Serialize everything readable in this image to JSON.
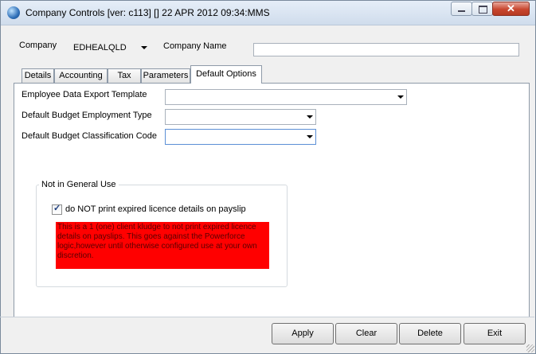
{
  "window": {
    "title": "Company Controls  [ver: c113] [] 22 APR 2012 09:34:MMS",
    "close_glyph": "✕"
  },
  "header": {
    "company_label": "Company",
    "company_value": "EDHEALQLD",
    "company_name_label": "Company Name",
    "company_name_value": ""
  },
  "tabs": [
    {
      "label": "Details"
    },
    {
      "label": "Accounting"
    },
    {
      "label": "Tax"
    },
    {
      "label": "Parameters"
    },
    {
      "label": "Default Options"
    }
  ],
  "default_options": {
    "export_template_label": "Employee Data Export Template",
    "export_template_value": "",
    "employment_type_label": "Default Budget Employment Type",
    "employment_type_value": "",
    "classification_label": "Default Budget Classification Code",
    "classification_value": ""
  },
  "group": {
    "title": "Not in General Use",
    "checkbox_label": "do NOT print expired licence details on payslip",
    "checkbox_checked": true,
    "checkmark": "✓",
    "note": "This is a 1 (one) client kludge to not print expired licence details on payslips. This goes against the Powerforce logic,however until otherwise configured use at your own discretion."
  },
  "buttons": {
    "apply": "Apply",
    "clear": "Clear",
    "delete": "Delete",
    "exit": "Exit"
  },
  "colors": {
    "note_background": "#ff0000",
    "window_background": "#f0f0f0"
  }
}
